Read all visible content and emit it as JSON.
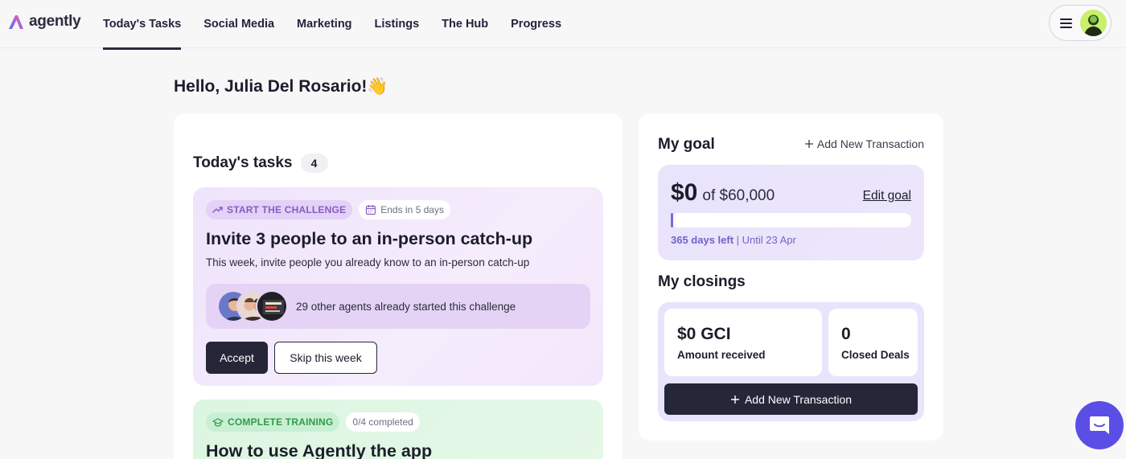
{
  "brand": {
    "name": "agently"
  },
  "nav": {
    "items": [
      {
        "label": "Today's Tasks",
        "active": true
      },
      {
        "label": "Social Media",
        "active": false
      },
      {
        "label": "Marketing",
        "active": false
      },
      {
        "label": "Listings",
        "active": false
      },
      {
        "label": "The Hub",
        "active": false
      },
      {
        "label": "Progress",
        "active": false
      }
    ]
  },
  "greeting": {
    "text": "Hello, Julia Del Rosario!👋"
  },
  "tasks": {
    "title": "Today's tasks",
    "count": "4",
    "challenge": {
      "badge": "START THE CHALLENGE",
      "ends": "Ends in 5 days",
      "title": "Invite 3 people to an in-person catch-up",
      "description": "This week, invite people you already know to an in-person catch-up",
      "agents_text": "29 other agents already started this challenge",
      "accept_label": "Accept",
      "skip_label": "Skip this week"
    },
    "training": {
      "badge": "COMPLETE TRAINING",
      "progress": "0/4 completed",
      "title": "How to use Agently the app"
    }
  },
  "goal": {
    "title": "My goal",
    "add_link": "Add New Transaction",
    "current": "$0",
    "target": "of $60,000",
    "edit_label": "Edit goal",
    "progress_fraction": 0.005,
    "days_left": "365 days left",
    "until": "| Until 23 Apr"
  },
  "closings": {
    "title": "My closings",
    "gci_value": "$0 GCI",
    "gci_label": "Amount received",
    "deals_value": "0",
    "deals_label": "Closed Deals",
    "add_button": "Add New Transaction"
  },
  "colors": {
    "accent": "#252638",
    "challenge_purple": "#8a5bc4",
    "training_green": "#2f9b4d",
    "progress": "#7b6ad6",
    "chat": "#5b4ee6"
  }
}
